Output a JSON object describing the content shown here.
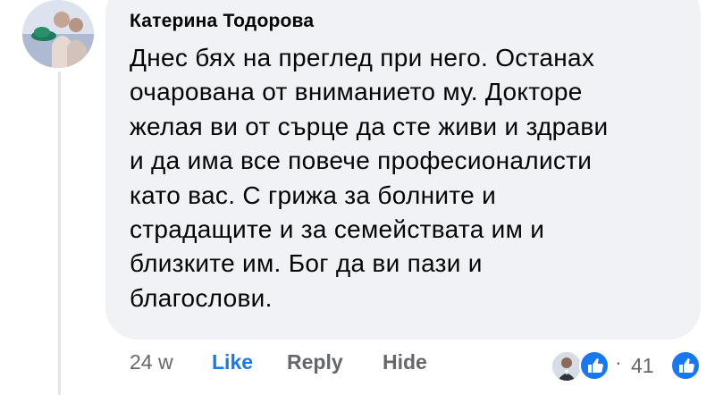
{
  "comment": {
    "author": "Катерина Тодорова",
    "text_lines": [
      "Днес бях на преглед при него. Останах",
      "очарована от вниманието му. Докторе",
      "желая ви от сърце да сте живи и здрави",
      "и да има все повече професионалисти",
      "като вас. С грижа за болните и",
      "страдащите и за семействата им и",
      "близките им. Бог да ви пази и",
      "благослови."
    ],
    "time": "24 w",
    "like_label": "Like",
    "reply_label": "Reply",
    "hide_label": "Hide"
  },
  "reactions": {
    "separator": "·",
    "count": "41",
    "icons": [
      "reactor-avatar",
      "like-icon"
    ]
  },
  "colors": {
    "bubble": "#f0f2f5",
    "like_blue": "#1877f2",
    "secondary_text": "#65676b",
    "primary_text": "#050505"
  }
}
